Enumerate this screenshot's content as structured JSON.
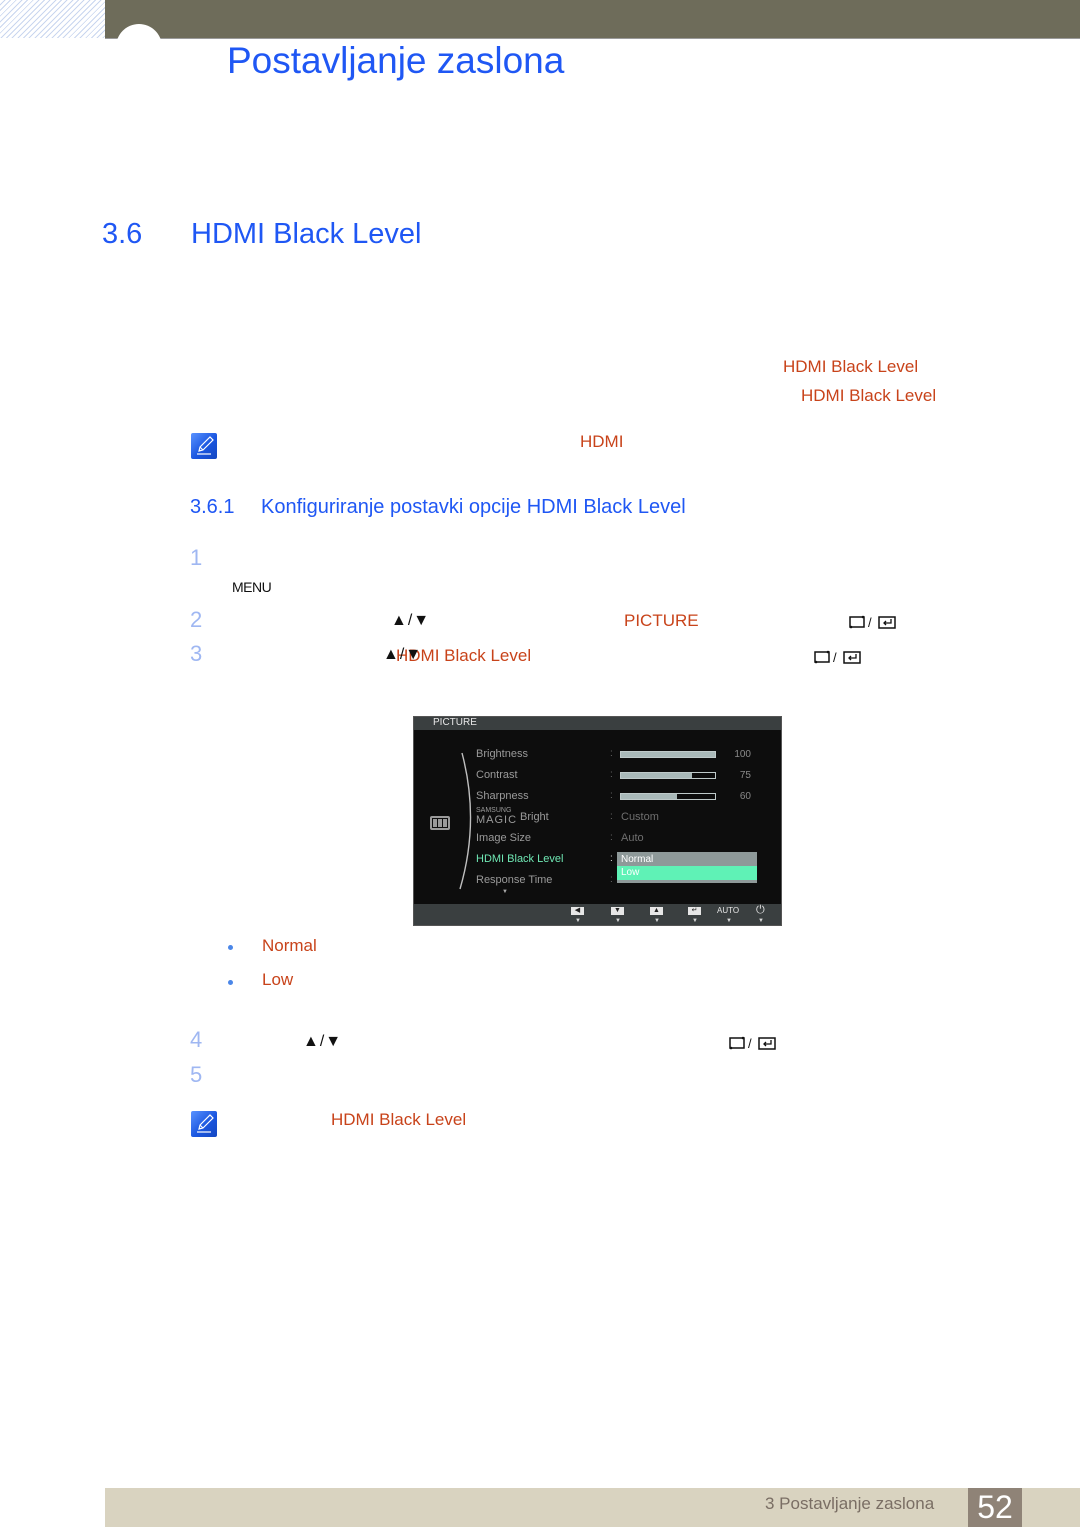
{
  "header": {
    "chapter_title": "Postavljanje zaslona",
    "colors": {
      "bar": "#6e6c5a",
      "title": "#1f57f4"
    }
  },
  "section": {
    "number": "3.6",
    "title": "HDMI Black Level"
  },
  "intro": {
    "line1_highlight": "HDMI Black Level",
    "line2_highlight": "HDMI Black Level"
  },
  "note1": {
    "icon": "note-pencil-icon",
    "highlight": "HDMI"
  },
  "subsection": {
    "number": "3.6.1",
    "title": "Konfiguriranje postavki opcije HDMI Black Level"
  },
  "steps": [
    {
      "num": "1",
      "key_label": "MENU"
    },
    {
      "num": "2",
      "nav_icon": "▲/▼",
      "highlight": "PICTURE",
      "confirm_icon": "source-enter-icon"
    },
    {
      "num": "3",
      "nav_icon": "▲/▼",
      "highlight": "HDMI Black Level",
      "confirm_icon": "source-enter-icon"
    },
    {
      "num": "4",
      "nav_icon": "▲/▼",
      "confirm_icon": "source-enter-icon"
    },
    {
      "num": "5"
    }
  ],
  "osd": {
    "title": "PICTURE",
    "rows": [
      {
        "label": "Brightness",
        "type": "bar",
        "value": 100,
        "display": "100"
      },
      {
        "label": "Contrast",
        "type": "bar",
        "value": 75,
        "display": "75"
      },
      {
        "label": "Sharpness",
        "type": "bar",
        "value": 60,
        "display": "60"
      },
      {
        "label": "Bright",
        "brand_top": "SAMSUNG",
        "brand_bottom": "MAGIC",
        "type": "text",
        "display": "Custom"
      },
      {
        "label": "Image Size",
        "type": "text",
        "display": "Auto"
      },
      {
        "label": "HDMI Black Level",
        "type": "dropdown",
        "selected": true
      },
      {
        "label": "Response Time",
        "type": "text",
        "display": ""
      }
    ],
    "dropdown_options": [
      "Normal",
      "Low"
    ],
    "dropdown_highlighted": "Low",
    "footer_buttons": [
      "left-arrow",
      "down-arrow",
      "up-arrow",
      "enter",
      "AUTO",
      "power"
    ],
    "auto_label": "AUTO",
    "colors": {
      "selected_label": "#6fe8b4",
      "highlight_option": "#5ff2b6",
      "dropdown_bg": "#8e9999"
    }
  },
  "options_list": [
    {
      "label": "Normal"
    },
    {
      "label": "Low"
    }
  ],
  "note2": {
    "icon": "note-pencil-icon",
    "highlight": "HDMI Black Level"
  },
  "footer": {
    "chapter_text": "3 Postavljanje zaslona",
    "page_number": "52"
  }
}
